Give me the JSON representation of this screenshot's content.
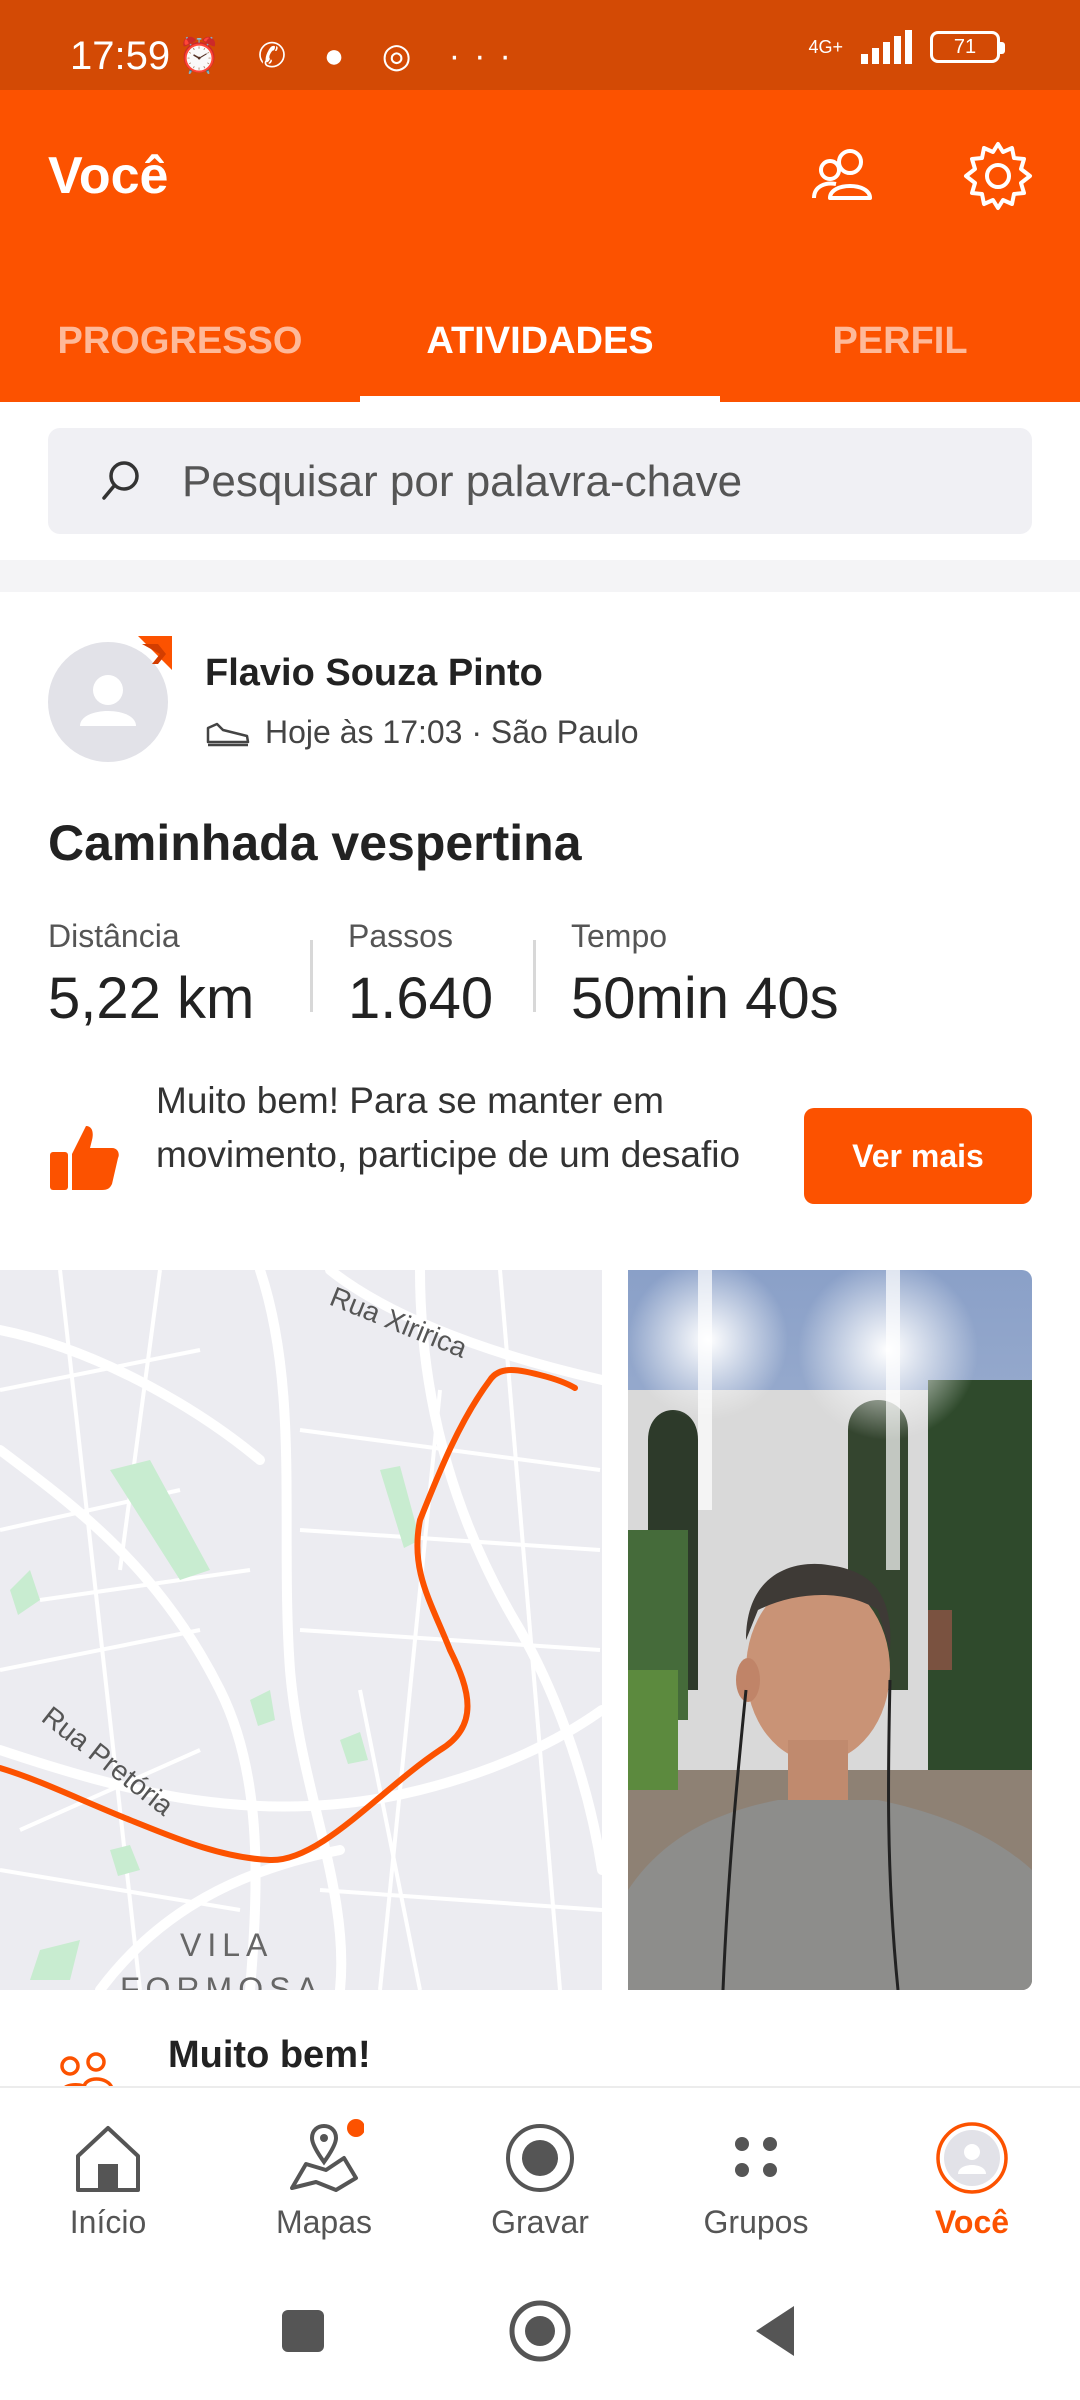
{
  "status_bar": {
    "time": "17:59",
    "notification_icons": "⏰ ✆ ● ◎ ···",
    "network": "4G+",
    "battery": "71"
  },
  "header": {
    "title": "Você",
    "tabs": [
      {
        "label": "PROGRESSO",
        "active": false
      },
      {
        "label": "ATIVIDADES",
        "active": true
      },
      {
        "label": "PERFIL",
        "active": false
      }
    ]
  },
  "search": {
    "placeholder": "Pesquisar por palavra-chave"
  },
  "activity": {
    "author": "Flavio Souza Pinto",
    "meta": "Hoje às 17:03 · São Paulo",
    "title": "Caminhada vespertina",
    "stats": [
      {
        "label": "Distância",
        "value": "5,22 km"
      },
      {
        "label": "Passos",
        "value": "1.640"
      },
      {
        "label": "Tempo",
        "value": "50min 40s"
      }
    ],
    "promo_text": "Muito bem! Para se manter em movimento, participe de um desafio",
    "promo_button": "Ver mais",
    "map_labels": {
      "street_1": "Rua Xiririca",
      "street_2": "Rua Pretória",
      "district_1": "VILA",
      "district_2": "FORMOSA"
    }
  },
  "next_card": {
    "title": "Muito bem!"
  },
  "bottom_nav": [
    {
      "label": "Início",
      "icon": "home-icon"
    },
    {
      "label": "Mapas",
      "icon": "map-icon"
    },
    {
      "label": "Gravar",
      "icon": "record-icon"
    },
    {
      "label": "Grupos",
      "icon": "groups-icon"
    },
    {
      "label": "Você",
      "icon": "profile-icon",
      "active": true
    }
  ],
  "colors": {
    "brand": "#fc5200",
    "status_bar": "#d34a05"
  }
}
